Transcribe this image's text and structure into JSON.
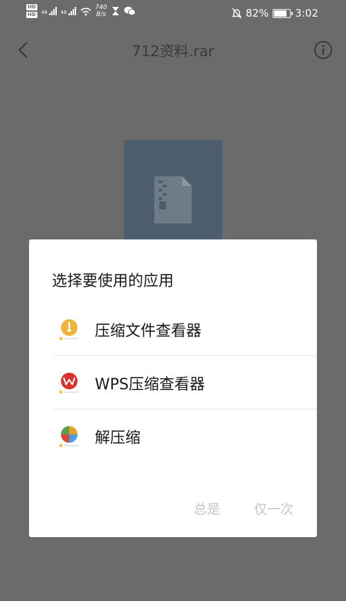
{
  "status_bar": {
    "hd1": "HD",
    "hd2": "HD",
    "net1": "46",
    "net2": "46",
    "speed_value": "740",
    "speed_unit": "B/s",
    "battery": "82%",
    "time": "3:02",
    "battery_level": 0.82,
    "icons": [
      "signal-icon",
      "wifi-icon",
      "hourglass-icon",
      "wechat-icon",
      "mute-icon",
      "battery-icon"
    ]
  },
  "header": {
    "title": "712资料.rar",
    "left_icon": "back-chevron-icon",
    "right_icon": "info-icon"
  },
  "dialog": {
    "title": "选择要使用的应用",
    "apps": [
      {
        "label": "压缩文件查看器",
        "icon": "archive-viewer-icon",
        "color": "#f0b43a"
      },
      {
        "label": "WPS压缩查看器",
        "icon": "wps-icon",
        "color": "#d8332e"
      },
      {
        "label": "解压缩",
        "icon": "unzip-icon",
        "color": "#5a9e4a"
      }
    ],
    "always_label": "总是",
    "once_label": "仅一次"
  }
}
